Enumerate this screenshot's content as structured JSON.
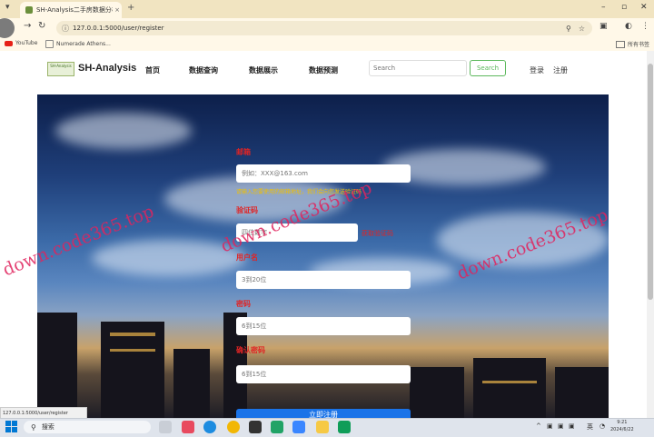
{
  "browser": {
    "tab_title": "SH-Analysis二手房数据分析",
    "url": "127.0.0.1:5000/user/register",
    "bookmarks": [
      "YouTube",
      "Numerade Athens..."
    ],
    "all_bookmarks": "所有书签",
    "status_url": "127.0.0.1:5000/user/register"
  },
  "site": {
    "logo_text": "SH-Analysis",
    "brand": "SH-Analysis",
    "nav": [
      "首页",
      "数据查询",
      "数据展示",
      "数据预测"
    ],
    "search_placeholder": "Search",
    "search_button": "Search",
    "login": "登录",
    "register": "注册"
  },
  "form": {
    "email_label": "邮箱",
    "email_placeholder": "例如：XXX@163.com",
    "email_hint": "请输入您要使用的邮箱地址，我们会向您发送验证码",
    "code_label": "验证码",
    "code_placeholder": "四位数字",
    "code_button": "获取验证码",
    "username_label": "用户名",
    "username_placeholder": "3到20位",
    "password_label": "密码",
    "password_placeholder": "6到15位",
    "confirm_label": "确认密码",
    "confirm_placeholder": "6到15位",
    "submit": "立即注册"
  },
  "watermark": "down.code365.top",
  "taskbar": {
    "search": "搜索",
    "ime": "英",
    "time": "9:21",
    "date": "2024/6/22"
  },
  "colors": {
    "label_red": "#e02424",
    "hint_yellow": "#f0c000",
    "submit_blue": "#1a73e8",
    "search_green": "#5cb85c",
    "watermark_pink": "#e0245e"
  }
}
